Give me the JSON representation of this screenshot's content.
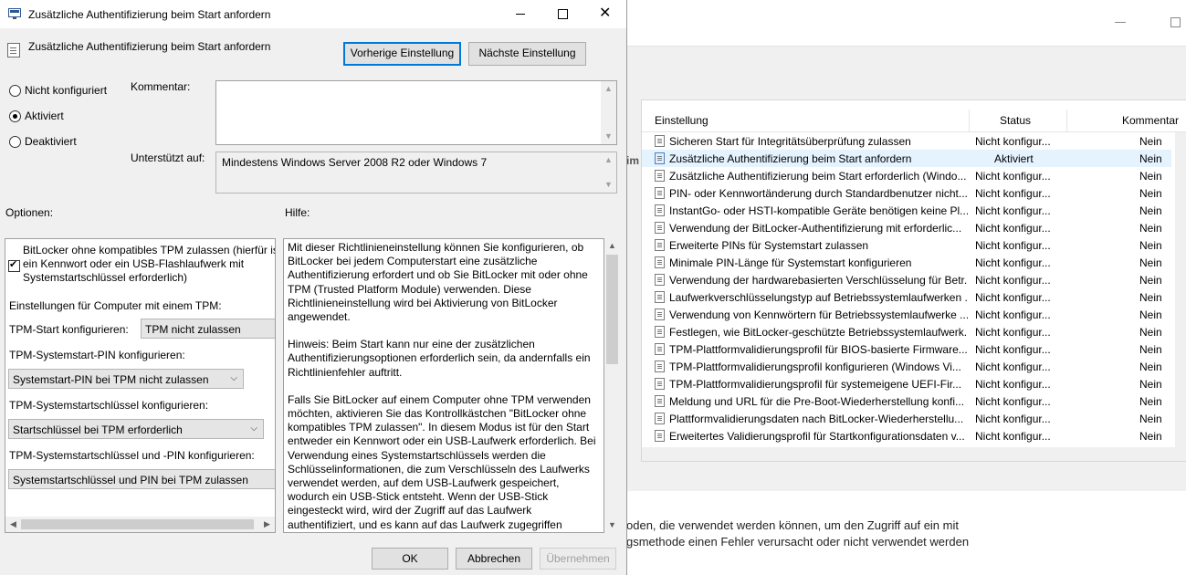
{
  "background_window": {
    "columns": {
      "setting": "Einstellung",
      "status": "Status",
      "comment": "Kommentar"
    },
    "truncated_nav_label": "im",
    "rows": [
      {
        "name": "Sicheren Start für Integritätsüberprüfung zulassen",
        "status": "Nicht konfigur...",
        "comment": "Nein"
      },
      {
        "name": "Zusätzliche Authentifizierung beim Start anfordern",
        "status": "Aktiviert",
        "comment": "Nein"
      },
      {
        "name": "Zusätzliche Authentifizierung beim Start erforderlich (Windo...",
        "status": "Nicht konfigur...",
        "comment": "Nein"
      },
      {
        "name": "PIN- oder Kennwortänderung durch Standardbenutzer nicht...",
        "status": "Nicht konfigur...",
        "comment": "Nein"
      },
      {
        "name": "InstantGo- oder HSTI-kompatible Geräte benötigen keine Pl...",
        "status": "Nicht konfigur...",
        "comment": "Nein"
      },
      {
        "name": "Verwendung der BitLocker-Authentifizierung mit erforderlic...",
        "status": "Nicht konfigur...",
        "comment": "Nein"
      },
      {
        "name": "Erweiterte PINs für Systemstart zulassen",
        "status": "Nicht konfigur...",
        "comment": "Nein"
      },
      {
        "name": "Minimale PIN-Länge für Systemstart konfigurieren",
        "status": "Nicht konfigur...",
        "comment": "Nein"
      },
      {
        "name": "Verwendung der hardwarebasierten Verschlüsselung für Betr...",
        "status": "Nicht konfigur...",
        "comment": "Nein"
      },
      {
        "name": "Laufwerkverschlüsselungstyp auf Betriebssystemlaufwerken ...",
        "status": "Nicht konfigur...",
        "comment": "Nein"
      },
      {
        "name": "Verwendung von Kennwörtern für Betriebssystemlaufwerke ...",
        "status": "Nicht konfigur...",
        "comment": "Nein"
      },
      {
        "name": "Festlegen, wie BitLocker-geschützte Betriebssystemlaufwerk...",
        "status": "Nicht konfigur...",
        "comment": "Nein"
      },
      {
        "name": "TPM-Plattformvalidierungsprofil für BIOS-basierte Firmware...",
        "status": "Nicht konfigur...",
        "comment": "Nein"
      },
      {
        "name": "TPM-Plattformvalidierungsprofil konfigurieren (Windows Vi...",
        "status": "Nicht konfigur...",
        "comment": "Nein"
      },
      {
        "name": "TPM-Plattformvalidierungsprofil für systemeigene UEFI-Fir...",
        "status": "Nicht konfigur...",
        "comment": "Nein"
      },
      {
        "name": "Meldung und URL für die Pre-Boot-Wiederherstellung konfi...",
        "status": "Nicht konfigur...",
        "comment": "Nein"
      },
      {
        "name": "Plattformvalidierungsdaten nach BitLocker-Wiederherstellu...",
        "status": "Nicht konfigur...",
        "comment": "Nein"
      },
      {
        "name": "Erweitertes Validierungsprofil für Startkonfigurationsdaten v...",
        "status": "Nicht konfigur...",
        "comment": "Nein"
      }
    ],
    "description_line1": "oden, die verwendet werden können, um den Zugriff auf ein mit",
    "description_line2": "gsmethode einen Fehler verursacht oder nicht verwendet werden"
  },
  "dialog": {
    "window_title": "Zusätzliche Authentifizierung beim Start anfordern",
    "setting_title": "Zusätzliche Authentifizierung beim Start anfordern",
    "prev_button": "Vorherige Einstellung",
    "next_button": "Nächste Einstellung",
    "radio_not_configured": "Nicht konfiguriert",
    "radio_enabled": "Aktiviert",
    "radio_disabled": "Deaktiviert",
    "selected_state": "Aktiviert",
    "comment_label": "Kommentar:",
    "comment_value": "",
    "supported_label": "Unterstützt auf:",
    "supported_value": "Mindestens Windows Server 2008 R2 oder Windows 7",
    "options_label": "Optionen:",
    "help_label": "Hilfe:",
    "options": {
      "checkbox_line1": "BitLocker ohne kompatibles TPM zulassen (hierfür ist",
      "checkbox_line2": "ein Kennwort oder ein USB-Flashlaufwerk mit",
      "checkbox_line3": "Systemstartschlüssel erforderlich)",
      "checkbox_checked": true,
      "tpm_section": "Einstellungen für Computer mit einem TPM:",
      "tpm_start_label": "TPM-Start konfigurieren:",
      "tpm_start_value": "TPM nicht zulassen",
      "tpm_pin_label": "TPM-Systemstart-PIN konfigurieren:",
      "tpm_pin_value": "Systemstart-PIN bei TPM nicht zulassen",
      "tpm_key_label": "TPM-Systemstartschlüssel konfigurieren:",
      "tpm_key_value": "Startschlüssel bei TPM erforderlich",
      "tpm_key_pin_label": "TPM-Systemstartschlüssel und -PIN konfigurieren:",
      "tpm_key_pin_value": "Systemstartschlüssel und PIN bei TPM zulassen"
    },
    "help_paragraphs": [
      "Mit dieser Richtlinieneinstellung können Sie konfigurieren, ob BitLocker bei jedem Computerstart eine zusätzliche Authentifizierung erfordert und ob Sie BitLocker mit oder ohne TPM (Trusted Platform Module) verwenden. Diese Richtlinieneinstellung wird bei Aktivierung von BitLocker angewendet.",
      "Hinweis: Beim Start kann nur eine der zusätzlichen Authentifizierungsoptionen erforderlich sein, da andernfalls ein Richtlinienfehler auftritt.",
      "Falls Sie BitLocker auf einem Computer ohne TPM verwenden möchten, aktivieren Sie das Kontrollkästchen \"BitLocker ohne kompatibles TPM zulassen\". In diesem Modus ist für den Start entweder ein Kennwort oder ein USB-Laufwerk erforderlich. Bei Verwendung eines Systemstartschlüssels werden die Schlüsselinformationen, die zum Verschlüsseln des Laufwerks verwendet werden, auf dem USB-Laufwerk gespeichert, wodurch ein USB-Stick entsteht. Wenn der USB-Stick eingesteckt wird, wird der Zugriff auf das Laufwerk authentifiziert, und es kann auf das Laufwerk zugegriffen werden. Wenn der USB-Stick verloren"
    ],
    "ok_button": "OK",
    "cancel_button": "Abbrechen",
    "apply_button": "Übernehmen"
  },
  "colors": {
    "accent": "#0078d7",
    "dialog_bg": "#f0f0f0",
    "selected_row": "#e5f3ff"
  }
}
